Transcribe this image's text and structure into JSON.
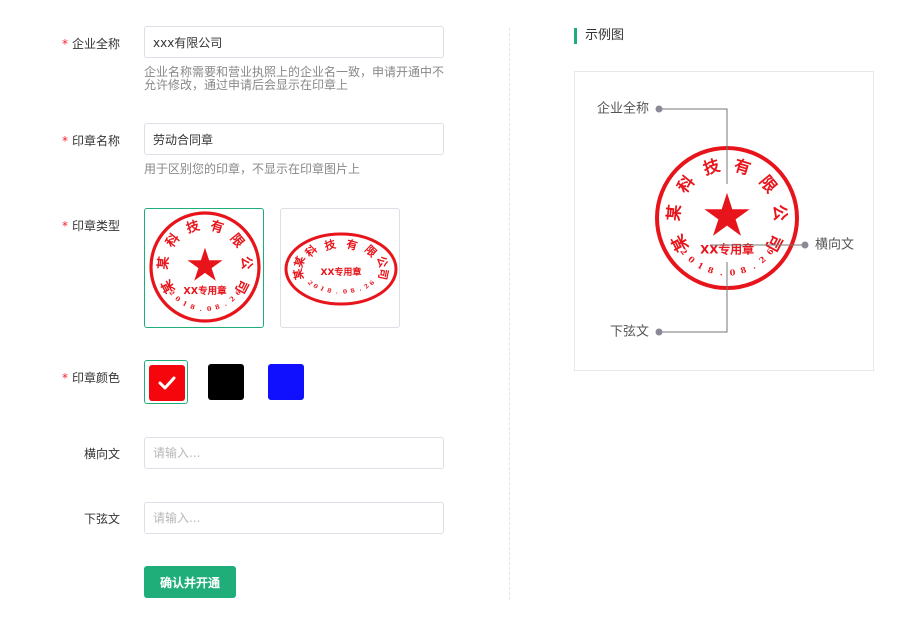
{
  "form": {
    "company": {
      "label": "企业全称",
      "value": "xxx有限公司",
      "help": "企业名称需要和营业执照上的企业名一致，申请开通中不允许修改，通过申请后会显示在印章上"
    },
    "seal_name": {
      "label": "印章名称",
      "value": "劳动合同章",
      "help": "用于区别您的印章，不显示在印章图片上"
    },
    "seal_type": {
      "label": "印章类型",
      "options": [
        "round",
        "oval"
      ],
      "selected": "round"
    },
    "seal_color": {
      "label": "印章颜色",
      "options": [
        "#f5060c",
        "#000000",
        "#1010ff"
      ],
      "selected": "#f5060c"
    },
    "horizontal": {
      "label": "横向文",
      "placeholder": "请输入..."
    },
    "bottom": {
      "label": "下弦文",
      "placeholder": "请输入..."
    },
    "required_mark": "*",
    "submit_label": "确认并开通"
  },
  "example": {
    "title": "示例图",
    "annotations": {
      "company": "企业全称",
      "horizontal": "横向文",
      "bottom": "下弦文"
    }
  },
  "seal": {
    "company_text": "某某科技有限公司",
    "horizontal_text": "XX专用章",
    "bottom_text": "2018.08.26",
    "color": "#e8141b"
  }
}
